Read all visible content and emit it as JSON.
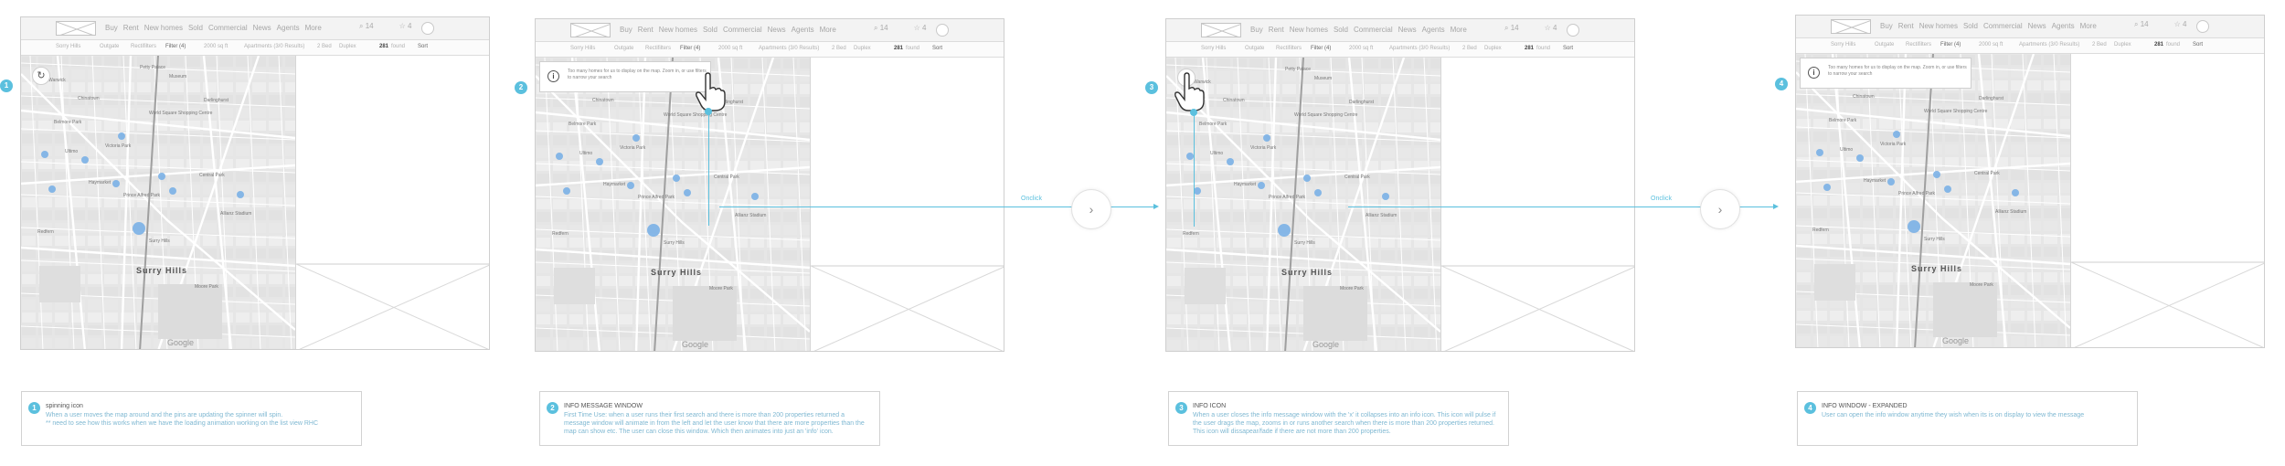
{
  "header": {
    "nav": [
      "Buy",
      "Rent",
      "New homes",
      "Sold",
      "Commercial",
      "News",
      "Agents",
      "More"
    ],
    "search_count": "14",
    "star_count": "4"
  },
  "filters": {
    "chips": [
      "Sorry Hills",
      "Outgate",
      "Rectifilters",
      "Filter (4)",
      "2000 sq ft",
      "Apartments (3/0 Results)",
      "2 Bed",
      "Duplex"
    ],
    "count": "281",
    "count_suffix": "found",
    "sort": "Sort"
  },
  "map": {
    "labels": [
      "Petty Palace",
      "Warwick",
      "Chinatown",
      "World Square Shopping Centre",
      "Ultimo",
      "Darlinghurst",
      "Haymarket",
      "Central Park",
      "Surry Hills",
      "Redfern",
      "Moore Park",
      "Prince Alfred Park",
      "Belmore Park",
      "Victoria Park",
      "Allianz Stadium",
      "Museum"
    ],
    "suburb": "Surry Hills",
    "google": "Google"
  },
  "refresh_icon": "↻",
  "info_text": "Too many homes for us to display on the map. Zoom in, or use filters to narrow your search",
  "info_i": "i",
  "flow": {
    "label": "Onclick",
    "next_glyph": "›"
  },
  "panels": [
    {
      "step": "1",
      "title": "spinning icon",
      "desc": "When a user moves the map around and the pins are updating the spinner will spin.\n** need to see how this works when we have the loading animation working on the list view RHC"
    },
    {
      "step": "2",
      "title": "INFO MESSAGE WINDOW",
      "desc": "First Time Use: when a user runs their first search and there is more than 200 properties returned a message window will animate in from the left and let the user know that there are more properties than the map can show etc. The user can close this window. Which then animates into just an 'info' icon."
    },
    {
      "step": "3",
      "title": "INFO ICON",
      "desc": "When a user closes the info message window with the 'x' it collapses into an info icon. This icon will pulse if the user drags the map, zooms in or runs another search when there is more than 200 properties returned. This icon will dissapear/fade if there are not more than 200 properties."
    },
    {
      "step": "4",
      "title": "INFO WINDOW - EXPANDED",
      "desc": "User can open the info window anytime they wish when its is on display to view the message"
    }
  ],
  "colors": {
    "accent": "#5bc0de",
    "pin": "#7ab0e6"
  }
}
